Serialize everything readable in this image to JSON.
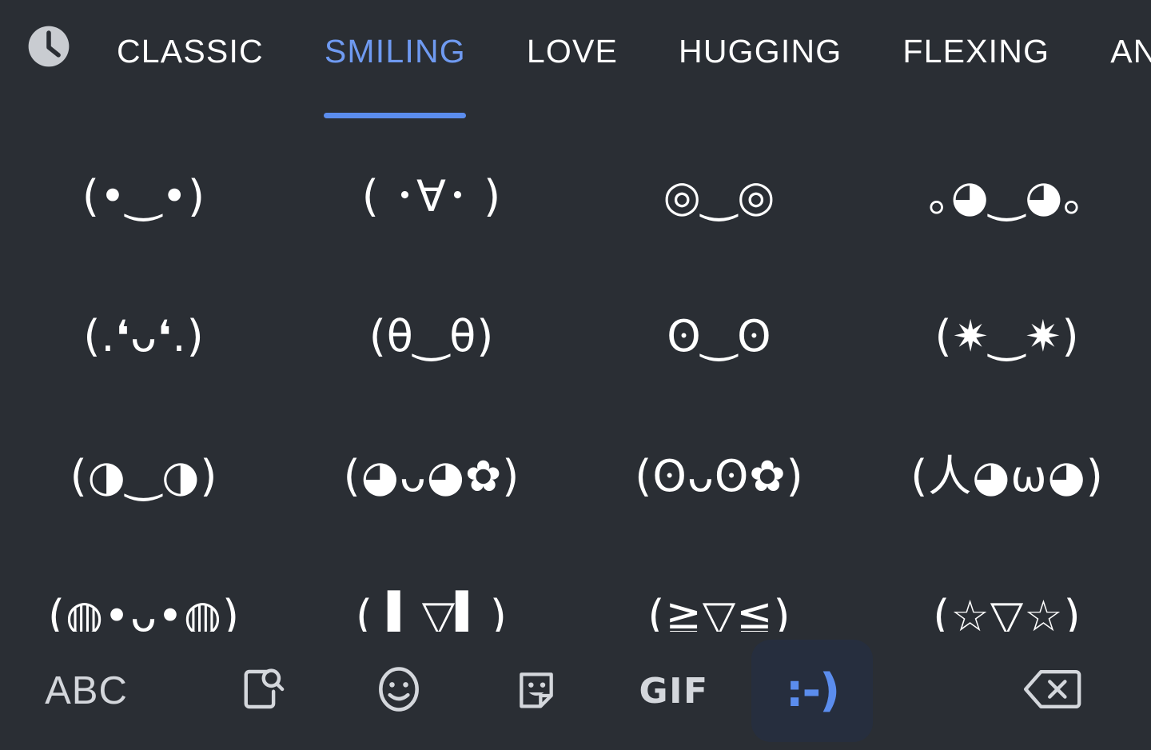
{
  "theme": {
    "background": "#2a2e34",
    "accent": "#5b8dee",
    "accent_text": "#6f9af1",
    "icon_color": "#d4d7dc",
    "text_color": "#ffffff",
    "selected_tool_bg": "#262e3e"
  },
  "tabbar": {
    "recent_icon": "clock-icon",
    "tabs": [
      {
        "label": "CLASSIC",
        "active": false
      },
      {
        "label": "SMILING",
        "active": true
      },
      {
        "label": "LOVE",
        "active": false
      },
      {
        "label": "HUGGING",
        "active": false
      },
      {
        "label": "FLEXING",
        "active": false
      },
      {
        "label": "AN",
        "active": false
      }
    ]
  },
  "grid": {
    "columns": 4,
    "items": [
      {
        "text": "(•‿•)"
      },
      {
        "text": "( ･∀･ )"
      },
      {
        "text": "◎‿◎"
      },
      {
        "text": "｡◕‿◕｡"
      },
      {
        "text": "(.❛ᴗ❛.)"
      },
      {
        "text": "(θ‿θ)"
      },
      {
        "text": "ʘ‿ʘ"
      },
      {
        "text": "(✷‿✷)"
      },
      {
        "text": "(◑‿◑)"
      },
      {
        "text": "(◕ᴗ◕✿)"
      },
      {
        "text": "(ʘᴗʘ✿)"
      },
      {
        "text": "(人◕ω◕)"
      },
      {
        "text": "(◍•ᴗ•◍)"
      },
      {
        "text": "( ▍▽▍)"
      },
      {
        "text": "(≧▽≦)"
      },
      {
        "text": "(☆▽☆)"
      }
    ]
  },
  "toolbar": {
    "abc_label": "ABC",
    "gif_label": "GIF",
    "kaomoji_label": ":-)",
    "icons": {
      "doc_search": "document-search-icon",
      "emoji": "emoji-smiley-icon",
      "sticker": "sticker-icon",
      "backspace": "backspace-icon"
    }
  }
}
